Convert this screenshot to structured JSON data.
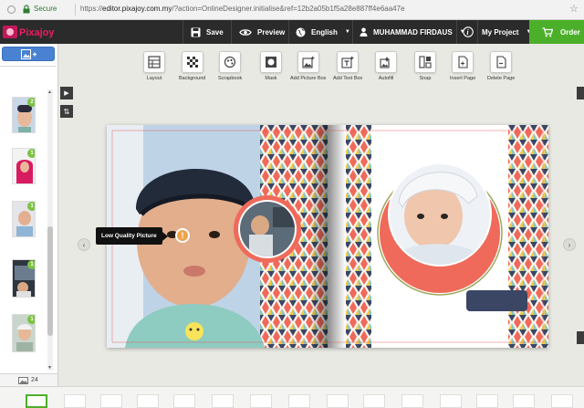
{
  "browser": {
    "secure_label": "Secure",
    "url_scheme": "https://",
    "url_host": "editor.pixajoy.com.my",
    "url_rest": "/?action=OnlineDesigner.initialise&ref=12b2a05b1f5a28e887ff4e6aa47e"
  },
  "topbar": {
    "logo_text": "Pixajoy",
    "save_label": "Save",
    "preview_label": "Preview",
    "language_label": "English",
    "user_label": "MUHAMMAD FIRDAUS",
    "project_label": "My Project",
    "order_label": "Order"
  },
  "toolbar": {
    "tools": [
      {
        "label": "Layout",
        "icon": "layout-icon"
      },
      {
        "label": "Background",
        "icon": "background-icon"
      },
      {
        "label": "Scrapbook",
        "icon": "scrapbook-icon"
      },
      {
        "label": "Mask",
        "icon": "mask-icon"
      },
      {
        "label": "Add Picture Box",
        "icon": "add-picture-box-icon"
      },
      {
        "label": "Add Text Box",
        "icon": "add-text-box-icon"
      },
      {
        "label": "Autofill",
        "icon": "autofill-icon"
      },
      {
        "label": "Snap",
        "icon": "snap-icon"
      },
      {
        "label": "Insert Page",
        "icon": "insert-page-icon"
      },
      {
        "label": "Delete Page",
        "icon": "delete-page-icon"
      }
    ]
  },
  "photos": {
    "count": "24",
    "thumbnails": [
      {
        "badge": "2"
      },
      {
        "badge": "1"
      },
      {
        "badge": "1"
      },
      {
        "badge": "1"
      },
      {
        "badge": "1"
      }
    ]
  },
  "canvas": {
    "warning_text": "Low Quality Picture",
    "warning_symbol": "!"
  },
  "colors": {
    "topbar_bg": "#2b2b2b",
    "order_green": "#4caf2a",
    "badge_green": "#7cc242",
    "add_button_blue": "#4a82d3",
    "frame_coral": "#ef6a5a",
    "text_box_navy": "#3b4664"
  }
}
